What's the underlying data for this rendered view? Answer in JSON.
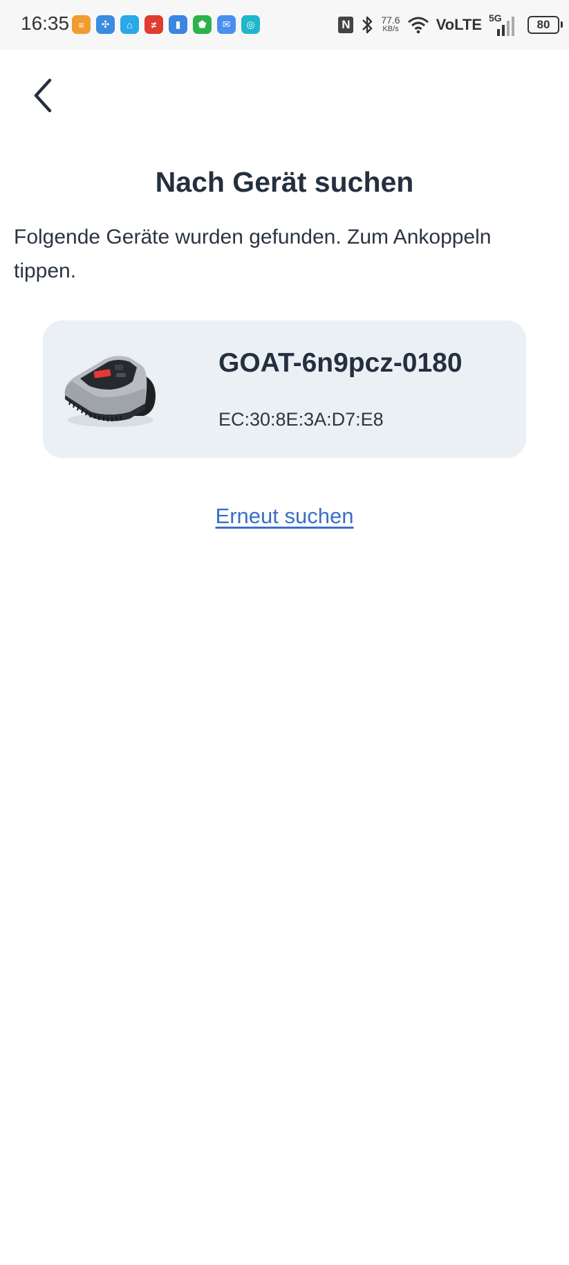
{
  "status_bar": {
    "time": "16:35",
    "app_icons": [
      {
        "name": "app-orange-icon",
        "color": "#f29b2e",
        "glyph": "≡"
      },
      {
        "name": "app-fan-icon",
        "color": "#3b8be0",
        "glyph": "✣"
      },
      {
        "name": "app-home-icon",
        "color": "#29a9e6",
        "glyph": "⌂"
      },
      {
        "name": "app-red-icon",
        "color": "#e13a2f",
        "glyph": "≠"
      },
      {
        "name": "app-battery-app-icon",
        "color": "#3b86e0",
        "glyph": "▮"
      },
      {
        "name": "app-shield-icon",
        "color": "#2bb34b",
        "glyph": "⬟"
      },
      {
        "name": "app-mail-icon",
        "color": "#4a8ff0",
        "glyph": "✉"
      },
      {
        "name": "app-teal-icon",
        "color": "#1fb7c9",
        "glyph": "◎"
      }
    ],
    "speed_value": "77.6",
    "speed_unit": "KB/s",
    "volte": "VoLTE",
    "network": "5G",
    "battery": "80"
  },
  "page": {
    "title": "Nach Gerät suchen",
    "description": "Folgende Geräte wurden gefunden. Zum Ankoppeln tippen."
  },
  "devices": [
    {
      "name": "GOAT-6n9pcz-0180",
      "mac": "EC:30:8E:3A:D7:E8"
    }
  ],
  "actions": {
    "rescan_label": "Erneut suchen"
  },
  "colors": {
    "text_dark": "#24303f",
    "card_background": "#ebf0f5",
    "link": "#3a6ec9"
  }
}
